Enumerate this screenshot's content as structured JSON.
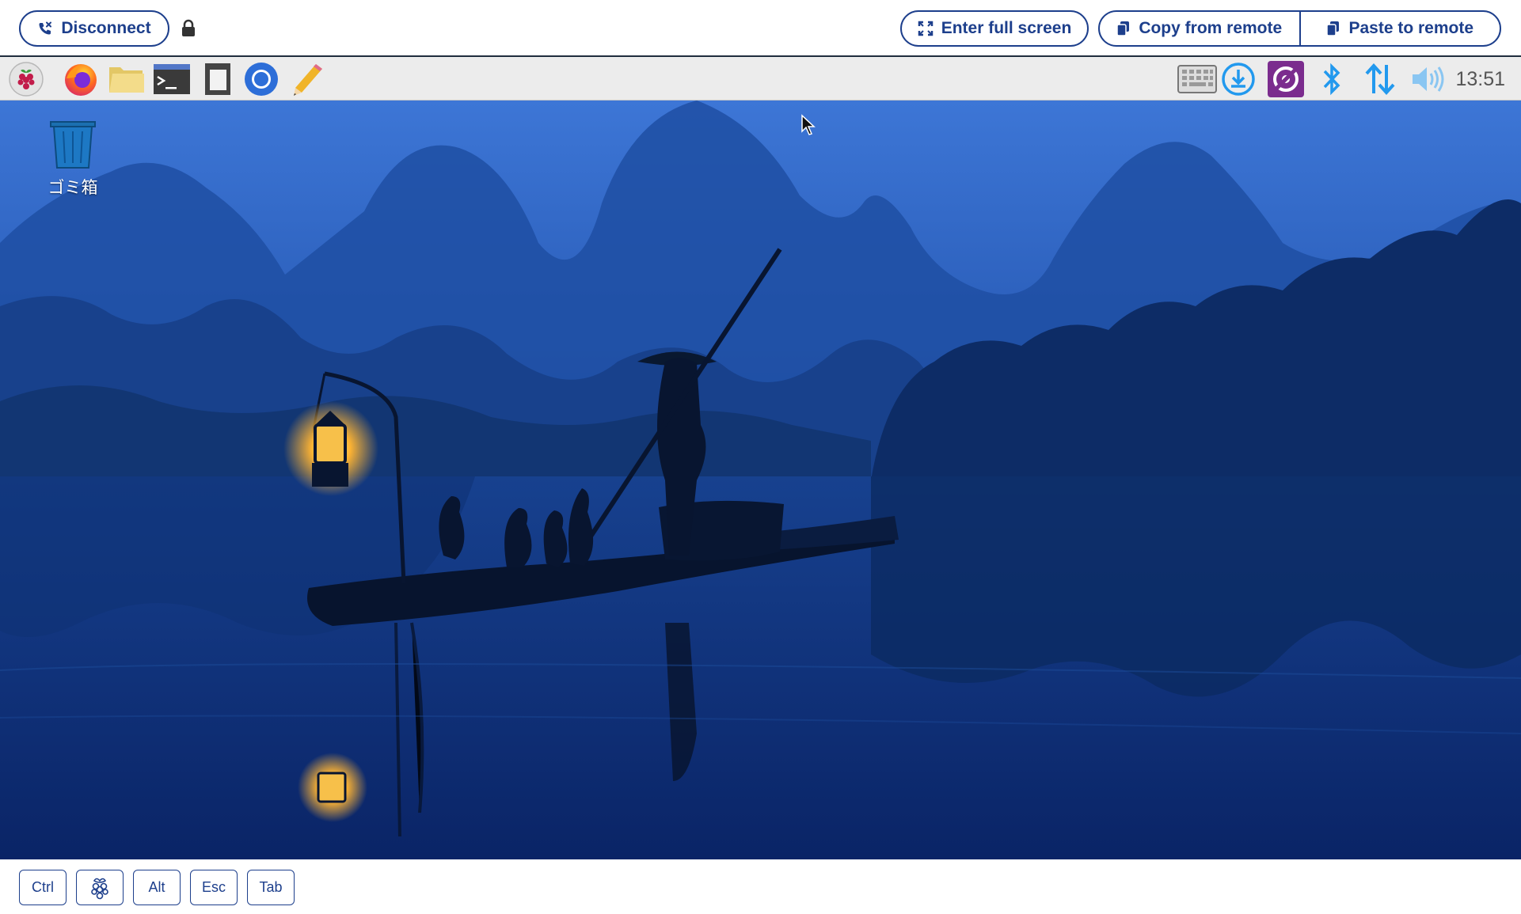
{
  "toolbar": {
    "disconnect_label": "Disconnect",
    "fullscreen_label": "Enter full screen",
    "copy_label": "Copy from remote",
    "paste_label": "Paste to remote"
  },
  "taskbar": {
    "apps": [
      "raspberry-menu-icon",
      "firefox-icon",
      "file-manager-icon",
      "terminal-icon",
      "sd-card-icon",
      "chromium-icon",
      "text-editor-icon"
    ],
    "tray": [
      "keyboard-icon",
      "download-icon",
      "vnc-icon",
      "bluetooth-icon",
      "network-icon",
      "volume-icon"
    ],
    "clock": "13:51"
  },
  "desktop": {
    "trash_label": "ゴミ箱"
  },
  "keys": {
    "ctrl": "Ctrl",
    "alt": "Alt",
    "esc": "Esc",
    "tab": "Tab"
  },
  "colors": {
    "accent": "#1d3f8c",
    "taskbar_bg": "#ececec",
    "wallpaper_sky": "#2f66c4",
    "wallpaper_water": "#0e2a6e"
  }
}
